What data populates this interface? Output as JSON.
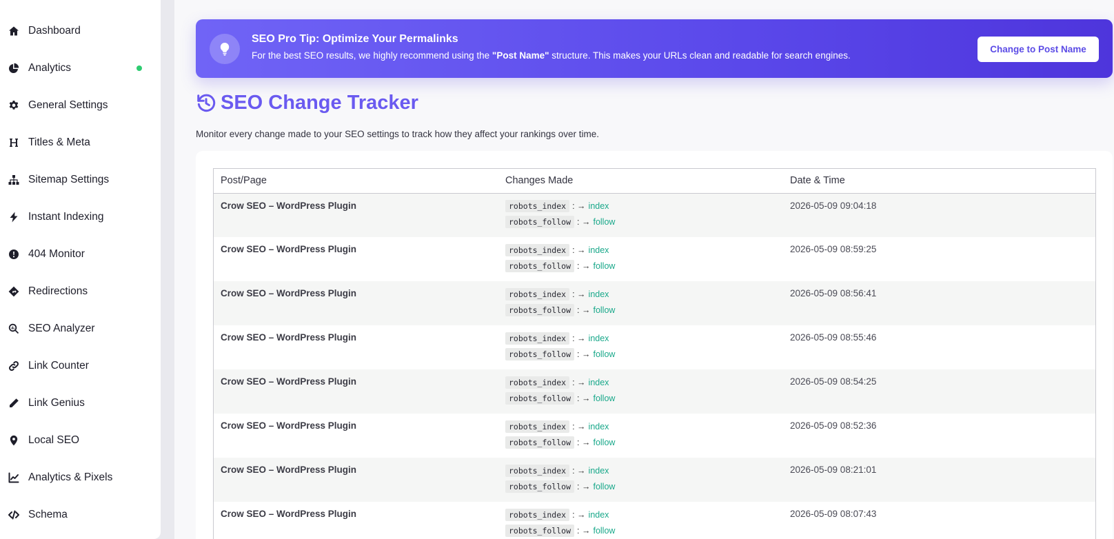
{
  "sidebar": {
    "items": [
      {
        "label": "Dashboard",
        "icon": "home-icon"
      },
      {
        "label": "Analytics",
        "icon": "pie-chart-icon",
        "status": "active-dot"
      },
      {
        "label": "General Settings",
        "icon": "gear-icon"
      },
      {
        "label": "Titles & Meta",
        "icon": "heading-icon"
      },
      {
        "label": "Sitemap Settings",
        "icon": "sitemap-icon"
      },
      {
        "label": "Instant Indexing",
        "icon": "bolt-icon"
      },
      {
        "label": "404 Monitor",
        "icon": "alert-circle-icon"
      },
      {
        "label": "Redirections",
        "icon": "directions-icon"
      },
      {
        "label": "SEO Analyzer",
        "icon": "search-chart-icon"
      },
      {
        "label": "Link Counter",
        "icon": "link-icon"
      },
      {
        "label": "Link Genius",
        "icon": "pen-icon"
      },
      {
        "label": "Local SEO",
        "icon": "map-pin-icon"
      },
      {
        "label": "Analytics & Pixels",
        "icon": "line-chart-icon"
      },
      {
        "label": "Schema",
        "icon": "code-icon"
      }
    ]
  },
  "banner": {
    "title": "SEO Pro Tip: Optimize Your Permalinks",
    "text_before": "For the best SEO results, we highly recommend using the ",
    "text_bold": "\"Post Name\"",
    "text_after": " structure. This makes your URLs clean and readable for search engines.",
    "button_label": "Change to Post Name"
  },
  "tracker": {
    "title": "SEO Change Tracker",
    "subtitle": "Monitor every change made to your SEO settings to track how they affect your rankings over time.",
    "columns": [
      "Post/Page",
      "Changes Made",
      "Date & Time"
    ],
    "change_separator": ": →",
    "rows": [
      {
        "post": "Crow SEO – WordPress Plugin",
        "changes": [
          {
            "key": "robots_index",
            "value": "index"
          },
          {
            "key": "robots_follow",
            "value": "follow"
          }
        ],
        "date": "2026-05-09 09:04:18"
      },
      {
        "post": "Crow SEO – WordPress Plugin",
        "changes": [
          {
            "key": "robots_index",
            "value": "index"
          },
          {
            "key": "robots_follow",
            "value": "follow"
          }
        ],
        "date": "2026-05-09 08:59:25"
      },
      {
        "post": "Crow SEO – WordPress Plugin",
        "changes": [
          {
            "key": "robots_index",
            "value": "index"
          },
          {
            "key": "robots_follow",
            "value": "follow"
          }
        ],
        "date": "2026-05-09 08:56:41"
      },
      {
        "post": "Crow SEO – WordPress Plugin",
        "changes": [
          {
            "key": "robots_index",
            "value": "index"
          },
          {
            "key": "robots_follow",
            "value": "follow"
          }
        ],
        "date": "2026-05-09 08:55:46"
      },
      {
        "post": "Crow SEO – WordPress Plugin",
        "changes": [
          {
            "key": "robots_index",
            "value": "index"
          },
          {
            "key": "robots_follow",
            "value": "follow"
          }
        ],
        "date": "2026-05-09 08:54:25"
      },
      {
        "post": "Crow SEO – WordPress Plugin",
        "changes": [
          {
            "key": "robots_index",
            "value": "index"
          },
          {
            "key": "robots_follow",
            "value": "follow"
          }
        ],
        "date": "2026-05-09 08:52:36"
      },
      {
        "post": "Crow SEO – WordPress Plugin",
        "changes": [
          {
            "key": "robots_index",
            "value": "index"
          },
          {
            "key": "robots_follow",
            "value": "follow"
          }
        ],
        "date": "2026-05-09 08:21:01"
      },
      {
        "post": "Crow SEO – WordPress Plugin",
        "changes": [
          {
            "key": "robots_index",
            "value": "index"
          },
          {
            "key": "robots_follow",
            "value": "follow"
          }
        ],
        "date": "2026-05-09 08:07:43"
      }
    ]
  },
  "colors": {
    "accent": "#6a5af0",
    "banner_start": "#7064f6",
    "banner_end": "#4e35dc",
    "value_green": "#19a88a",
    "status_dot": "#2ecc71"
  }
}
